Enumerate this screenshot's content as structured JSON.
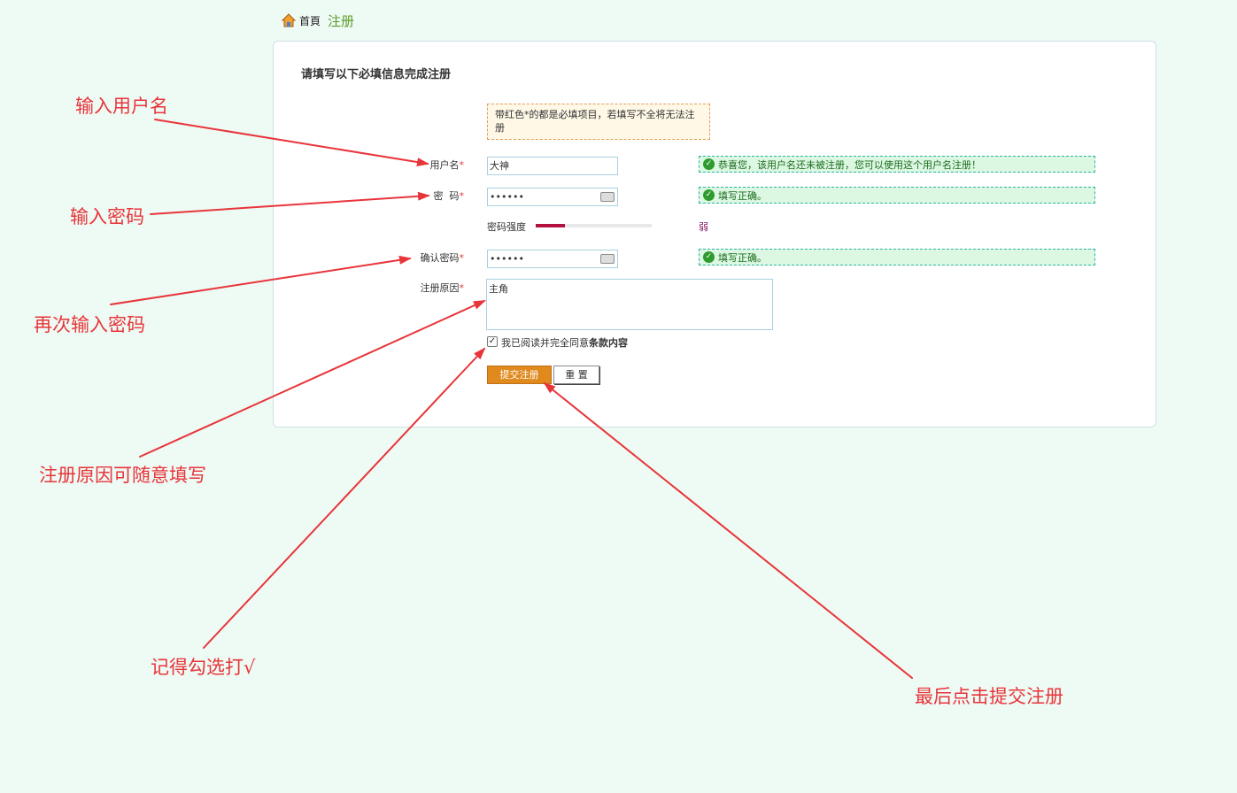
{
  "breadcrumb": {
    "home": "首頁",
    "current": "注册"
  },
  "form": {
    "title": "请填写以下必填信息完成注册",
    "notice": "带红色*的都是必填项目，若填写不全将无法注册",
    "username": {
      "label": "用户名",
      "required": "*",
      "value": "大神",
      "tip": "恭喜您，该用户名还未被注册，您可以使用这个用户名注册！"
    },
    "password": {
      "label": "密  码",
      "required": "*",
      "value": "••••••",
      "tip": "填写正确。"
    },
    "strength": {
      "label": "密码强度",
      "level": "弱",
      "fraction": 0.25
    },
    "confirm": {
      "label": "确认密码",
      "required": "*",
      "value": "••••••",
      "tip": "填写正确。"
    },
    "reason": {
      "label": "注册原因",
      "required": "*",
      "value": "主角"
    },
    "agree": {
      "prefix": "我已阅读并完全同意",
      "terms": "条款内容",
      "checked": true
    },
    "submit_label": "提交注册",
    "reset_label": "重 置"
  },
  "annotations": {
    "username": "输入用户名",
    "password": "输入密码",
    "confirm": "再次输入密码",
    "reason": "注册原因可随意填写",
    "checkbox": "记得勾选打√",
    "submit": "最后点击提交注册"
  },
  "colors": {
    "annotation": "#e8353a",
    "accent": "#e08a1e",
    "success": "#2f9a2f"
  }
}
